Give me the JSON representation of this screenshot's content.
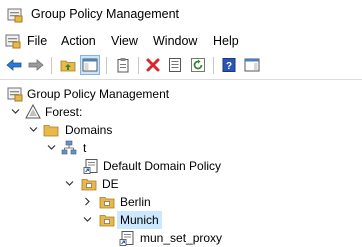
{
  "window": {
    "title": "Group Policy Management"
  },
  "menu": [
    "File",
    "Action",
    "View",
    "Window",
    "Help"
  ],
  "toolbar": {
    "buttons": [
      {
        "name": "back-button",
        "icon": "arrow-left-icon"
      },
      {
        "name": "forward-button",
        "icon": "arrow-right-icon"
      },
      {
        "name": "up-folder-button",
        "icon": "folder-up-icon"
      },
      {
        "name": "show-hide-tree-button",
        "icon": "console-tree-icon",
        "active": true
      },
      {
        "name": "properties-button",
        "icon": "clipboard-icon"
      },
      {
        "name": "delete-button",
        "icon": "red-x-icon"
      },
      {
        "name": "export-list-button",
        "icon": "document-icon"
      },
      {
        "name": "refresh-button",
        "icon": "refresh-icon"
      },
      {
        "name": "help-button",
        "icon": "help-book-icon"
      },
      {
        "name": "show-action-pane-button",
        "icon": "action-pane-icon"
      }
    ]
  },
  "tree": {
    "root": "Group Policy Management",
    "forest": "Forest:",
    "domains": "Domains",
    "domain": "t",
    "default_policy": "Default Domain Policy",
    "ou_de": "DE",
    "ou_berlin": "Berlin",
    "ou_munich": "Munich",
    "gpo_link": "mun_set_proxy"
  },
  "colors": {
    "selection": "#cce8ff",
    "folder": "#e8b84a",
    "accent_blue": "#1e5fb4"
  }
}
